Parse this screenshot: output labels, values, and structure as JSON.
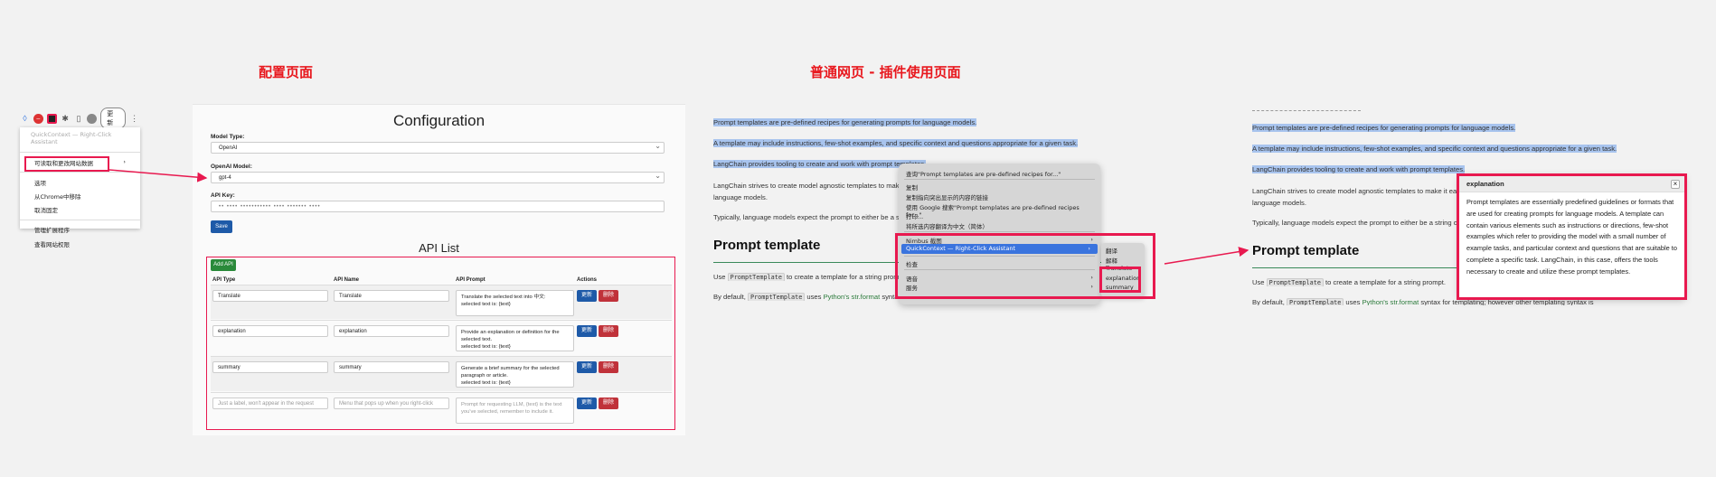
{
  "titles": {
    "config": "配置页面",
    "webpage": "普通网页 - 插件使用页面"
  },
  "toolbar": {
    "update_label": "更新"
  },
  "ext_menu": {
    "header": "QuickContext — Right-Click Assistant",
    "items": [
      "可读取和更改网站数据",
      "选项",
      "从Chrome中移除",
      "取消固定",
      "管理扩展程序",
      "查看网站权限"
    ]
  },
  "config": {
    "title": "Configuration",
    "model_type_label": "Model Type:",
    "model_type_value": "OpenAI",
    "openai_model_label": "OpenAI Model:",
    "openai_model_value": "gpt-4",
    "api_key_label": "API Key:",
    "api_key_value": "•• •••• ••••••••••• •••• ••••••• ••••",
    "save_label": "Save",
    "api_list_title": "API List",
    "add_api_label": "Add API",
    "columns": [
      "API Type",
      "API Name",
      "API Prompt",
      "Actions"
    ],
    "update_label": "更新",
    "delete_label": "删除",
    "rows": [
      {
        "type": "Translate",
        "name": "Translate",
        "prompt": "Translate the selected text into 中文:\nselected text is: {text}"
      },
      {
        "type": "explanation",
        "name": "explanation",
        "prompt": "Provide an explanation or definition for the selected text.\nselected text is: {text}"
      },
      {
        "type": "summary",
        "name": "summary",
        "prompt": "Generate a brief summary for the selected paragraph or article.\nselected text is: {text}"
      }
    ],
    "new_row_placeholders": {
      "type": "Just a label, won't appear in the request",
      "name": "Menu that pops up when you right-click",
      "prompt": "Prompt for requesting LLM, {text} is the text you've selected, remember to include it."
    }
  },
  "webpage": {
    "p1": "Prompt templates are pre-defined recipes for generating prompts for language models.",
    "p2": "A template may include instructions, few-shot examples, and specific context and questions appropriate for a given task.",
    "p3": "LangChain provides tooling to create and work with prompt templates.",
    "p4a": "LangChain strives to create model agnostic templates to make it easy to reuse existing templates across different",
    "p4b": "language models.",
    "p5": "Typically, language models expect the prompt to either be a string or else a list of chat messages.",
    "heading": "Prompt template",
    "p6_pre": "Use ",
    "p6_code": "PromptTemplate",
    "p6_post": " to create a template for a string prompt.",
    "p7_pre": "By default, ",
    "p7_code": "PromptTemplate",
    "p7_mid": " uses ",
    "p7_link": "Python's str.format",
    "p7_post": " syntax for templating; however other templating syntax is"
  },
  "context_menu": {
    "items": [
      "查询\"Prompt templates are pre-defined recipes for...\"",
      "复制",
      "复制指向突出显示的内容的链接",
      "使用 Google 搜索\"Prompt templates are pre-defined recipes for...\"",
      "打印...",
      "将所选内容翻译为中文（简体）",
      "Nimbus 截图",
      "QuickContext — Right-Click Assistant",
      "检查",
      "语音",
      "服务"
    ],
    "submenu": [
      "翻译",
      "解释",
      "Translate",
      "explanation",
      "summary"
    ]
  },
  "popup": {
    "title": "explanation",
    "close": "×",
    "body": "Prompt templates are essentially predefined guidelines or formats that are used for creating prompts for language models. A template can contain various elements such as instructions or directions, few-shot examples which refer to providing the model with a small number of example tasks, and particular context and questions that are suitable to complete a specific task. LangChain, in this case, offers the tools necessary to create and utilize these prompt templates."
  }
}
